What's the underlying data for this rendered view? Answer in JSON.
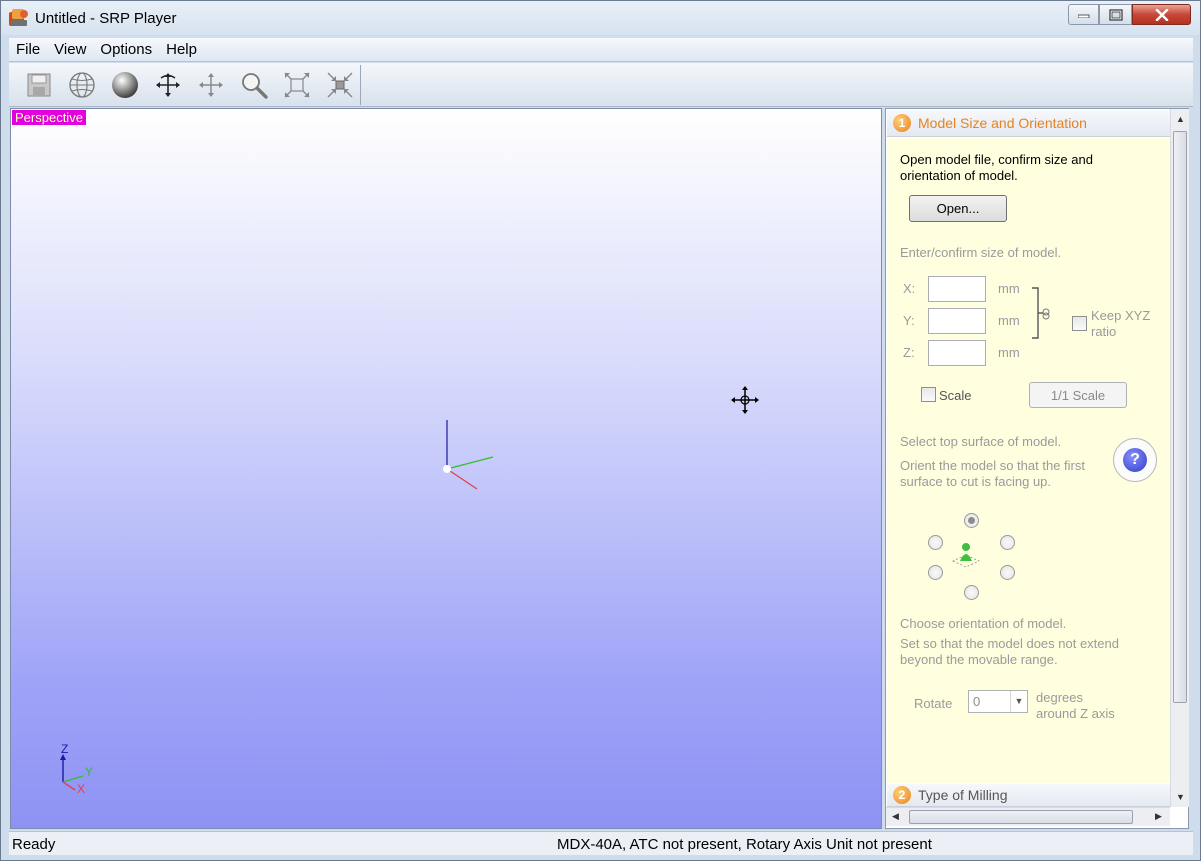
{
  "window": {
    "title": "Untitled - SRP Player"
  },
  "menu": [
    "File",
    "View",
    "Options",
    "Help"
  ],
  "toolbar": {
    "icons": [
      "save-icon",
      "wireframe-globe-icon",
      "shaded-sphere-icon",
      "rotate-icon",
      "pan-icon",
      "zoom-icon",
      "fit-view-icon",
      "zoom-extents-icon"
    ]
  },
  "viewport": {
    "label": "Perspective"
  },
  "axis_labels": {
    "z": "Z",
    "y": "Y",
    "x": "X"
  },
  "panel": {
    "section1": {
      "number": "1",
      "title": "Model Size and Orientation",
      "intro": "Open model file, confirm size and orientation of model.",
      "open_button": "Open...",
      "size_heading": "Enter/confirm size of model.",
      "x_label": "X:",
      "y_label": "Y:",
      "z_label": "Z:",
      "unit": "mm",
      "keep_ratio": "Keep XYZ ratio",
      "scale": "Scale",
      "one_to_one": "1/1 Scale",
      "top_surface_heading": "Select top surface of model.",
      "top_surface_desc": "Orient the model so that the first surface to cut is facing up.",
      "help": "?",
      "orientation_heading": "Choose orientation of model.",
      "orientation_desc": "Set so that the model does not extend beyond the movable range.",
      "rotate_label": "Rotate",
      "rotate_value": "0",
      "rotate_unit": "degrees around Z axis"
    },
    "section2": {
      "number": "2",
      "title": "Type of Milling"
    }
  },
  "status": {
    "left": "Ready",
    "right": "MDX-40A, ATC not present, Rotary Axis Unit not present"
  }
}
